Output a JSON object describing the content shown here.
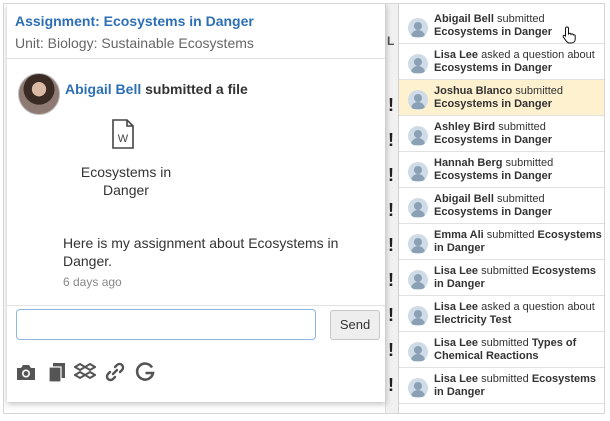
{
  "assignment": {
    "title": "Assignment: Ecosystems in Danger",
    "unit": "Unit: Biology: Sustainable Ecosystems"
  },
  "post": {
    "author": "Abigail Bell",
    "action": " submitted a file",
    "file_line1": "Ecosystems in",
    "file_line2": "Danger",
    "message_line1": "Here is my assignment about Ecosystems in",
    "message_line2": "Danger.",
    "time": "6 days ago"
  },
  "reply": {
    "placeholder": "",
    "send_label": "Send"
  },
  "toolbar": {
    "icons": [
      "camera-icon",
      "files-icon",
      "dropbox-icon",
      "link-icon",
      "google-icon"
    ]
  },
  "background": {
    "letter": "L",
    "bang": "!"
  },
  "notifications": [
    {
      "name": "Abigail Bell",
      "action": " submitted ",
      "subject": "Ecosystems in Danger",
      "active": false
    },
    {
      "name": "Lisa Lee",
      "action": " asked a question about ",
      "subject": "Ecosystems in Danger",
      "active": false
    },
    {
      "name": "Joshua Blanco",
      "action": " submitted ",
      "subject": "Ecosystems in Danger",
      "active": true
    },
    {
      "name": "Ashley Bird",
      "action": " submitted ",
      "subject": "Ecosystems in Danger",
      "active": false
    },
    {
      "name": "Hannah Berg",
      "action": " submitted ",
      "subject": "Ecosystems in Danger",
      "active": false
    },
    {
      "name": "Abigail Bell",
      "action": " submitted ",
      "subject": "Ecosystems in Danger",
      "active": false
    },
    {
      "name": "Emma Ali",
      "action": " submitted ",
      "subject": "Ecosystems in Danger",
      "active": false
    },
    {
      "name": "Lisa Lee",
      "action": " submitted ",
      "subject": "Ecosystems in Danger",
      "active": false
    },
    {
      "name": "Lisa Lee",
      "action": " asked a question about ",
      "subject": "Electricity Test",
      "active": false
    },
    {
      "name": "Lisa Lee",
      "action": " submitted ",
      "subject": "Types of Chemical Reactions",
      "active": false
    },
    {
      "name": "Lisa Lee",
      "action": " submitted ",
      "subject": "Ecosystems in Danger",
      "active": false
    }
  ],
  "colors": {
    "link_blue": "#2d6fb5",
    "highlight": "#fdf1cf"
  }
}
